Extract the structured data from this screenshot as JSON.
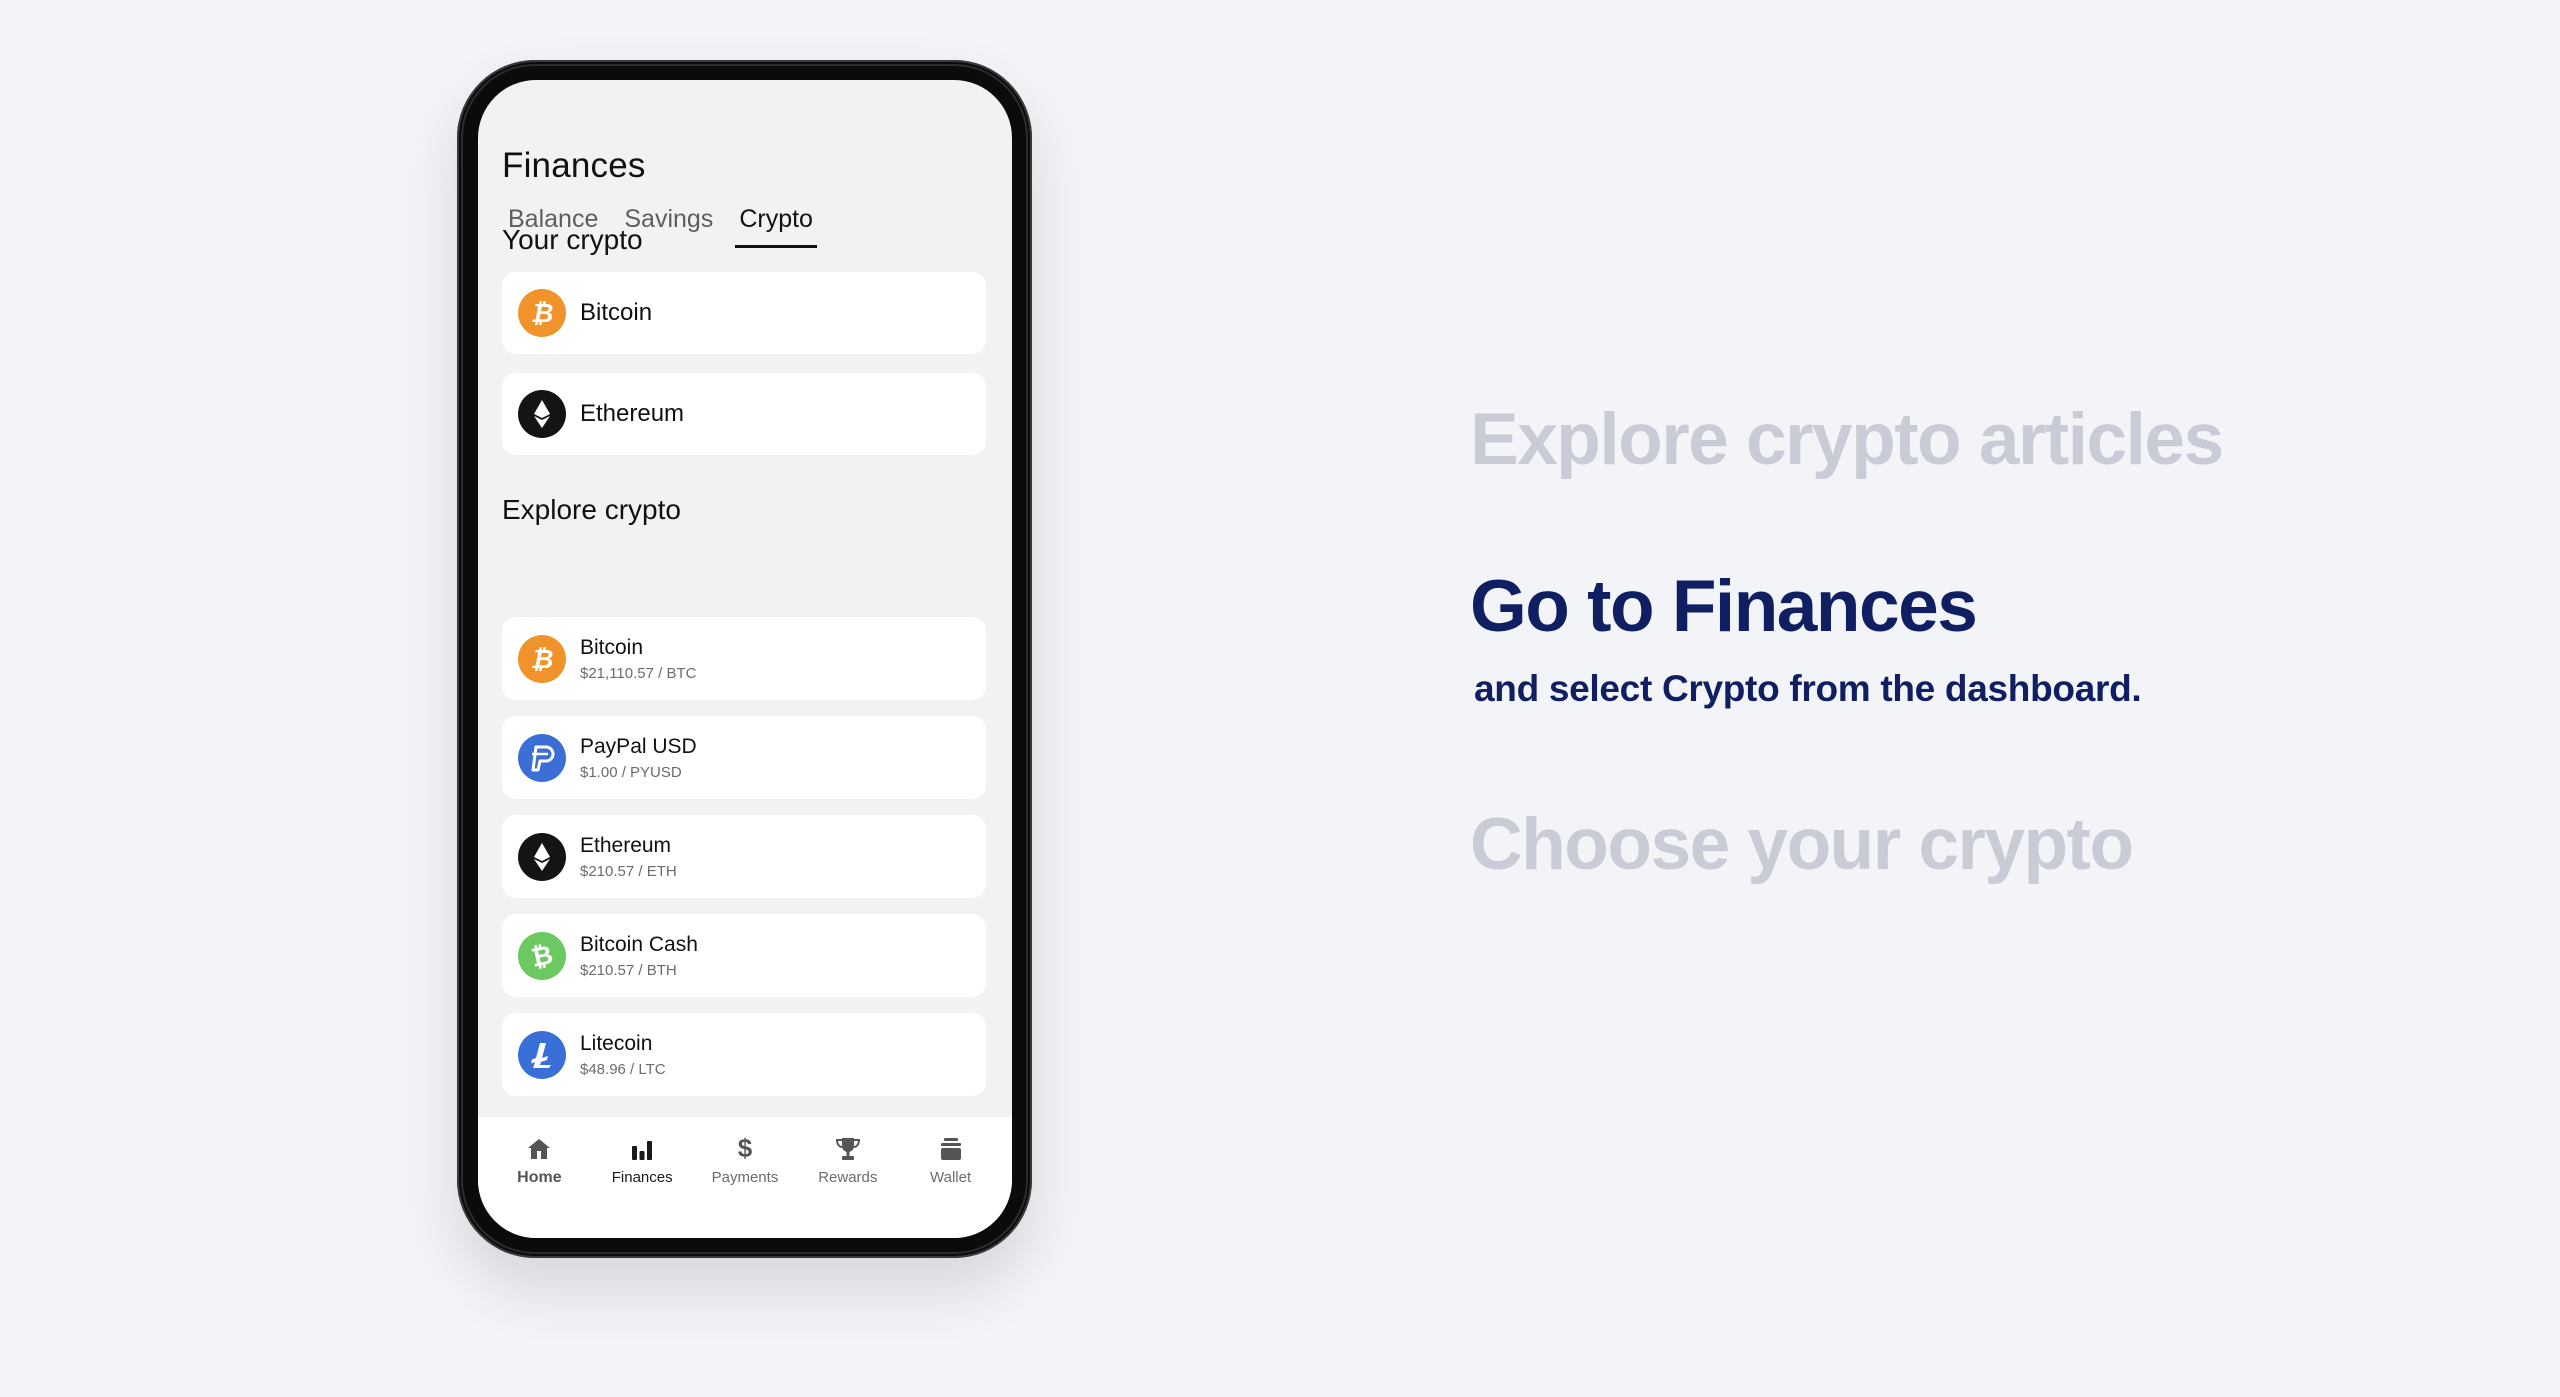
{
  "app": {
    "title": "Finances",
    "tabs": [
      {
        "label": "Balance",
        "active": false
      },
      {
        "label": "Savings",
        "active": false
      },
      {
        "label": "Crypto",
        "active": true
      }
    ],
    "your_crypto": {
      "title": "Your crypto",
      "items": [
        {
          "name": "Bitcoin",
          "icon": "bitcoin-icon",
          "color": "#f0932b"
        },
        {
          "name": "Ethereum",
          "icon": "ethereum-icon",
          "color": "#141414"
        }
      ]
    },
    "explore_crypto": {
      "title": "Explore crypto",
      "items": [
        {
          "name": "Bitcoin",
          "price": "$21,110.57 / BTC",
          "icon": "bitcoin-icon",
          "color": "#f0932b"
        },
        {
          "name": "PayPal USD",
          "price": "$1.00 / PYUSD",
          "icon": "paypal-usd-icon",
          "color": "#3c6fd6"
        },
        {
          "name": "Ethereum",
          "price": "$210.57 / ETH",
          "icon": "ethereum-icon",
          "color": "#141414"
        },
        {
          "name": "Bitcoin Cash",
          "price": "$210.57 / BTH",
          "icon": "bitcoin-cash-icon",
          "color": "#6cc860"
        },
        {
          "name": "Litecoin",
          "price": "$48.96 / LTC",
          "icon": "litecoin-icon",
          "color": "#3a6fd8"
        }
      ]
    },
    "bottom_nav": [
      {
        "label": "Home",
        "icon": "home-icon"
      },
      {
        "label": "Finances",
        "icon": "bar-chart-icon",
        "active": true
      },
      {
        "label": "Payments",
        "icon": "dollar-icon"
      },
      {
        "label": "Rewards",
        "icon": "trophy-icon"
      },
      {
        "label": "Wallet",
        "icon": "wallet-icon"
      }
    ]
  },
  "steps": {
    "previous": "Explore crypto articles",
    "current": "Go to Finances",
    "current_sub": "and select Crypto from the dashboard.",
    "next": "Choose your crypto"
  },
  "colors": {
    "background": "#f3f4f8",
    "accent_navy": "#0f1f62",
    "inactive_text": "#c9ccd6"
  }
}
